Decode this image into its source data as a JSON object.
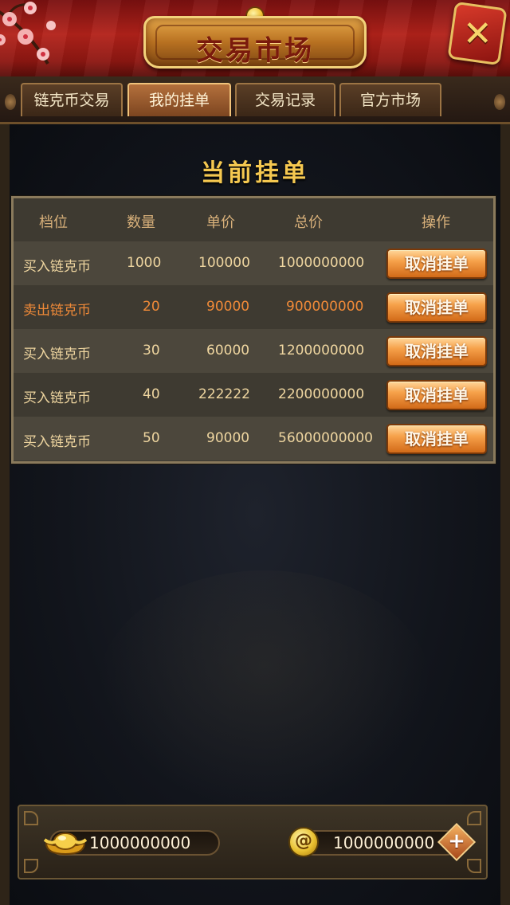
{
  "header": {
    "title": "交易市场",
    "close_icon": "x-close-icon"
  },
  "tabs": [
    {
      "label": "链克币交易",
      "active": false
    },
    {
      "label": "我的挂单",
      "active": true
    },
    {
      "label": "交易记录",
      "active": false
    },
    {
      "label": "官方市场",
      "active": false
    }
  ],
  "section": {
    "title": "当前挂单"
  },
  "table": {
    "headers": [
      "档位",
      "数量",
      "单价",
      "总价",
      "操作"
    ],
    "rows": [
      {
        "type": "买入链克币",
        "qty": "1000",
        "price": "100000",
        "total": "1000000000",
        "action": "取消挂单",
        "side": "buy"
      },
      {
        "type": "卖出链克币",
        "qty": "20",
        "price": "90000",
        "total": "900000000",
        "action": "取消挂单",
        "side": "sell"
      },
      {
        "type": "买入链克币",
        "qty": "30",
        "price": "60000",
        "total": "1200000000",
        "action": "取消挂单",
        "side": "buy"
      },
      {
        "type": "买入链克币",
        "qty": "40",
        "price": "222222",
        "total": "2200000000",
        "action": "取消挂单",
        "side": "buy"
      },
      {
        "type": "买入链克币",
        "qty": "50",
        "price": "90000",
        "total": "56000000000",
        "action": "取消挂单",
        "side": "buy"
      }
    ]
  },
  "footer": {
    "gold_amount": "1000000000",
    "coin_amount": "1000000000",
    "coin_glyph": "@",
    "plus_label": "+"
  },
  "colors": {
    "buy_text": "#efd6a0",
    "sell_text": "#f08a38",
    "title_gold": "#f5c850",
    "button_orange": "#f6a14a"
  }
}
